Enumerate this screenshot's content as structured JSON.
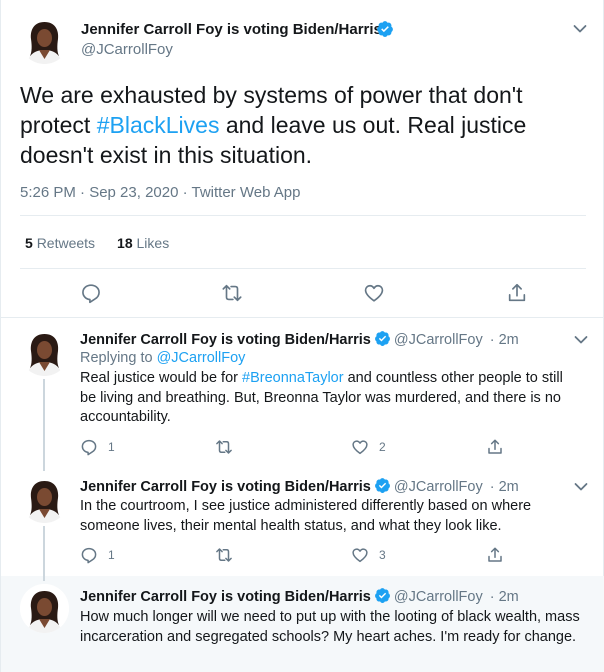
{
  "colors": {
    "accent": "#1da1f2",
    "text": "#14171a",
    "muted": "#657786",
    "divider": "#e6ecf0"
  },
  "main_tweet": {
    "author_name": "Jennifer Carroll Foy is voting Biden/Harris",
    "handle": "@JCarrollFoy",
    "text_before": "We are exhausted by systems of power that don't protect ",
    "hashtag": "#BlackLives",
    "text_after": " and leave us out. Real justice doesn't exist in this situation.",
    "timestamp": "5:26 PM · Sep 23, 2020 · Twitter Web App",
    "retweets_count": "5",
    "retweets_label": "Retweets",
    "likes_count": "18",
    "likes_label": "Likes",
    "actions": [
      "reply-icon",
      "retweet-icon",
      "like-icon",
      "share-icon"
    ]
  },
  "replies": [
    {
      "author_name": "Jennifer Carroll Foy is voting Biden/Harris",
      "handle": "@JCarrollFoy",
      "time": "· 2m",
      "replying_label": "Replying to",
      "replying_to": "@JCarrollFoy",
      "text_before": "Real justice would be for ",
      "hashtag": "#BreonnaTaylor",
      "text_after": " and countless other people to still be living and breathing. But, Breonna Taylor was murdered, and there is no accountability.",
      "reply_count": "1",
      "retweet_count": "",
      "like_count": "2"
    },
    {
      "author_name": "Jennifer Carroll Foy is voting Biden/Harris",
      "handle": "@JCarrollFoy",
      "time": "· 2m",
      "text": "In the courtroom, I see justice administered differently based on where someone lives, their mental health status, and what they look like.",
      "reply_count": "1",
      "retweet_count": "",
      "like_count": "3"
    },
    {
      "author_name": "Jennifer Carroll Foy is voting Biden/Harris",
      "handle": "@JCarrollFoy",
      "time": "· 2m",
      "text": "How much longer will we need to put up with the looting of black wealth, mass incarceration and segregated schools? My heart aches. I'm ready for change."
    }
  ]
}
